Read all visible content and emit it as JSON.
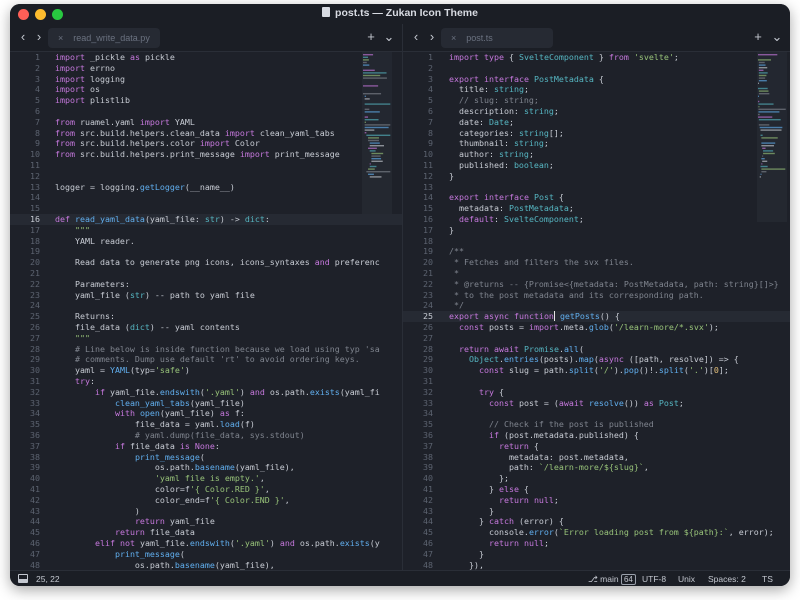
{
  "window": {
    "title": "post.ts — Zukan Icon Theme"
  },
  "left_pane": {
    "tab_label": "read_write_data.py",
    "current_line": "16",
    "lines": [
      {
        "n": "1",
        "t": "import _pickle as pickle"
      },
      {
        "n": "2",
        "t": "import errno"
      },
      {
        "n": "3",
        "t": "import logging"
      },
      {
        "n": "4",
        "t": "import os"
      },
      {
        "n": "5",
        "t": "import plistlib"
      },
      {
        "n": "6",
        "t": ""
      },
      {
        "n": "7",
        "t": "from ruamel.yaml import YAML"
      },
      {
        "n": "8",
        "t": "from src.build.helpers.clean_data import clean_yaml_tabs"
      },
      {
        "n": "9",
        "t": "from src.build.helpers.color import Color"
      },
      {
        "n": "10",
        "t": "from src.build.helpers.print_message import print_message"
      },
      {
        "n": "11",
        "t": ""
      },
      {
        "n": "12",
        "t": ""
      },
      {
        "n": "13",
        "t": "logger = logging.getLogger(__name__)"
      },
      {
        "n": "14",
        "t": ""
      },
      {
        "n": "15",
        "t": ""
      },
      {
        "n": "16",
        "t": "def read_yaml_data(yaml_file: str) -> dict:"
      },
      {
        "n": "17",
        "t": "    \"\"\""
      },
      {
        "n": "18",
        "t": "    YAML reader."
      },
      {
        "n": "19",
        "t": ""
      },
      {
        "n": "20",
        "t": "    Read data to generate png icons, icons_syntaxes and preferenc"
      },
      {
        "n": "21",
        "t": ""
      },
      {
        "n": "22",
        "t": "    Parameters:"
      },
      {
        "n": "23",
        "t": "    yaml_file (str) -- path to yaml file"
      },
      {
        "n": "24",
        "t": ""
      },
      {
        "n": "25",
        "t": "    Returns:"
      },
      {
        "n": "26",
        "t": "    file_data (dict) -- yaml contents"
      },
      {
        "n": "27",
        "t": "    \"\"\""
      },
      {
        "n": "28",
        "t": "    # Line below is inside function because we load using typ 'sa"
      },
      {
        "n": "29",
        "t": "    # comments. Dump use default 'rt' to avoid ordering keys."
      },
      {
        "n": "30",
        "t": "    yaml = YAML(typ='safe')"
      },
      {
        "n": "31",
        "t": "    try:"
      },
      {
        "n": "32",
        "t": "        if yaml_file.endswith('.yaml') and os.path.exists(yaml_fi"
      },
      {
        "n": "33",
        "t": "            clean_yaml_tabs(yaml_file)"
      },
      {
        "n": "34",
        "t": "            with open(yaml_file) as f:"
      },
      {
        "n": "35",
        "t": "                file_data = yaml.load(f)"
      },
      {
        "n": "36",
        "t": "                # yaml.dump(file_data, sys.stdout)"
      },
      {
        "n": "37",
        "t": "            if file_data is None:"
      },
      {
        "n": "38",
        "t": "                print_message("
      },
      {
        "n": "39",
        "t": "                    os.path.basename(yaml_file),"
      },
      {
        "n": "40",
        "t": "                    'yaml file is empty.',"
      },
      {
        "n": "41",
        "t": "                    color=f'{ Color.RED }',"
      },
      {
        "n": "42",
        "t": "                    color_end=f'{ Color.END }',"
      },
      {
        "n": "43",
        "t": "                )"
      },
      {
        "n": "44",
        "t": "                return yaml_file"
      },
      {
        "n": "45",
        "t": "            return file_data"
      },
      {
        "n": "46",
        "t": "        elif not yaml_file.endswith('.yaml') and os.path.exists(y"
      },
      {
        "n": "47",
        "t": "            print_message("
      },
      {
        "n": "48",
        "t": "                os.path.basename(yaml_file),"
      }
    ]
  },
  "right_pane": {
    "tab_label": "post.ts",
    "current_line": "25",
    "lines": [
      {
        "n": "1",
        "t": "import type { SvelteComponent } from 'svelte';"
      },
      {
        "n": "2",
        "t": ""
      },
      {
        "n": "3",
        "t": "export interface PostMetadata {"
      },
      {
        "n": "4",
        "t": "  title: string;"
      },
      {
        "n": "5",
        "t": "  // slug: string;"
      },
      {
        "n": "6",
        "t": "  description: string;"
      },
      {
        "n": "7",
        "t": "  date: Date;"
      },
      {
        "n": "8",
        "t": "  categories: string[];"
      },
      {
        "n": "9",
        "t": "  thumbnail: string;"
      },
      {
        "n": "10",
        "t": "  author: string;"
      },
      {
        "n": "11",
        "t": "  published: boolean;"
      },
      {
        "n": "12",
        "t": "}"
      },
      {
        "n": "13",
        "t": ""
      },
      {
        "n": "14",
        "t": "export interface Post {"
      },
      {
        "n": "15",
        "t": "  metadata: PostMetadata;"
      },
      {
        "n": "16",
        "t": "  default: SvelteComponent;"
      },
      {
        "n": "17",
        "t": "}"
      },
      {
        "n": "18",
        "t": ""
      },
      {
        "n": "19",
        "t": "/**"
      },
      {
        "n": "20",
        "t": " * Fetches and filters the svx files."
      },
      {
        "n": "21",
        "t": " *"
      },
      {
        "n": "22",
        "t": " * @returns -- {Promise<{metadata: PostMetadata, path: string}[]>}"
      },
      {
        "n": "23",
        "t": " * to the post metadata and its corresponding path."
      },
      {
        "n": "24",
        "t": " */"
      },
      {
        "n": "25",
        "t": "export async function getPosts() {"
      },
      {
        "n": "26",
        "t": "  const posts = import.meta.glob('/learn-more/*.svx');"
      },
      {
        "n": "27",
        "t": ""
      },
      {
        "n": "28",
        "t": "  return await Promise.all("
      },
      {
        "n": "29",
        "t": "    Object.entries(posts).map(async ([path, resolve]) => {"
      },
      {
        "n": "30",
        "t": "      const slug = path.split('/').pop()!.split('.')[0];"
      },
      {
        "n": "31",
        "t": ""
      },
      {
        "n": "32",
        "t": "      try {"
      },
      {
        "n": "33",
        "t": "        const post = (await resolve()) as Post;"
      },
      {
        "n": "34",
        "t": ""
      },
      {
        "n": "35",
        "t": "        // Check if the post is published"
      },
      {
        "n": "36",
        "t": "        if (post.metadata.published) {"
      },
      {
        "n": "37",
        "t": "          return {"
      },
      {
        "n": "38",
        "t": "            metadata: post.metadata,"
      },
      {
        "n": "39",
        "t": "            path: `/learn-more/${slug}`,"
      },
      {
        "n": "40",
        "t": "          };"
      },
      {
        "n": "41",
        "t": "        } else {"
      },
      {
        "n": "42",
        "t": "          return null;"
      },
      {
        "n": "43",
        "t": "        }"
      },
      {
        "n": "44",
        "t": "      } catch (error) {"
      },
      {
        "n": "45",
        "t": "        console.error(`Error loading post from ${path}:`, error);"
      },
      {
        "n": "46",
        "t": "        return null;"
      },
      {
        "n": "47",
        "t": "      }"
      },
      {
        "n": "48",
        "t": "    }),"
      }
    ]
  },
  "icons": {
    "back": "‹",
    "forward": "›",
    "new_tab": "+",
    "tab_menu": "⌄",
    "close": "×"
  },
  "status": {
    "position": "25, 22",
    "branch": "main",
    "branch_count": "64",
    "encoding": "UTF-8",
    "line_endings": "Unix",
    "indentation": "Spaces: 2",
    "syntax": "TS"
  },
  "colors": {
    "keyword": "#c678dd",
    "type": "#56b6c2",
    "string": "#98c379",
    "comment": "#7f848e",
    "function": "#61afef",
    "number": "#e5c07b",
    "text": "#c8ccd4"
  }
}
